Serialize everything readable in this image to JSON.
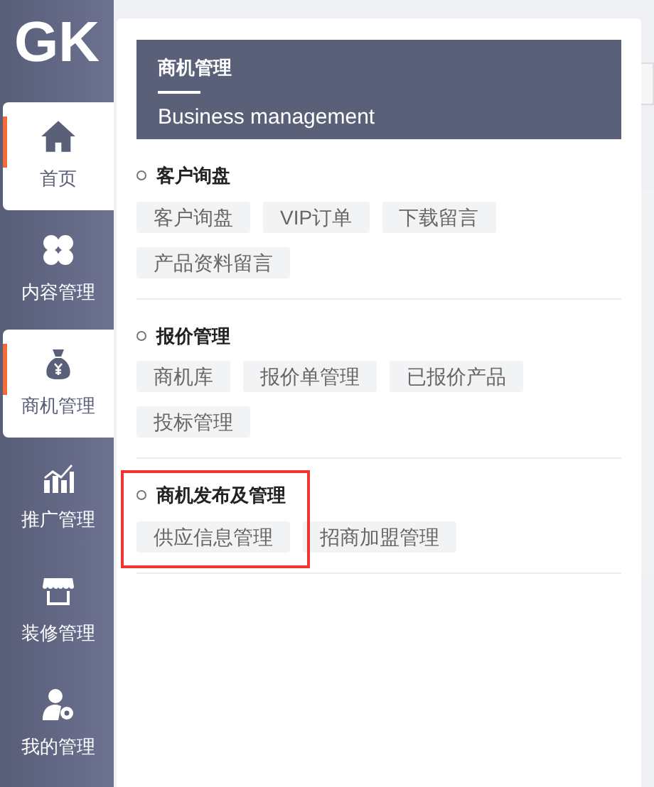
{
  "sidebar": {
    "logo": "GK",
    "items": [
      {
        "label": "首页",
        "kind": "home",
        "selected": true
      },
      {
        "label": "内容管理",
        "kind": "clover",
        "selected": false
      },
      {
        "label": "商机管理",
        "kind": "moneybag",
        "selected": true
      },
      {
        "label": "推广管理",
        "kind": "chart",
        "selected": false
      },
      {
        "label": "装修管理",
        "kind": "store",
        "selected": false
      },
      {
        "label": "我的管理",
        "kind": "usergear",
        "selected": false
      }
    ]
  },
  "popup": {
    "title": "商机管理",
    "subtitle": "Business management",
    "sections": [
      {
        "title": "客户询盘",
        "highlighted": false,
        "tags": [
          "客户询盘",
          "VIP订单",
          "下载留言",
          "产品资料留言"
        ]
      },
      {
        "title": "报价管理",
        "highlighted": false,
        "tags": [
          "商机库",
          "报价单管理",
          "已报价产品",
          "投标管理"
        ]
      },
      {
        "title": "商机发布及管理",
        "highlighted": true,
        "tags": [
          "供应信息管理",
          "招商加盟管理"
        ]
      }
    ]
  }
}
